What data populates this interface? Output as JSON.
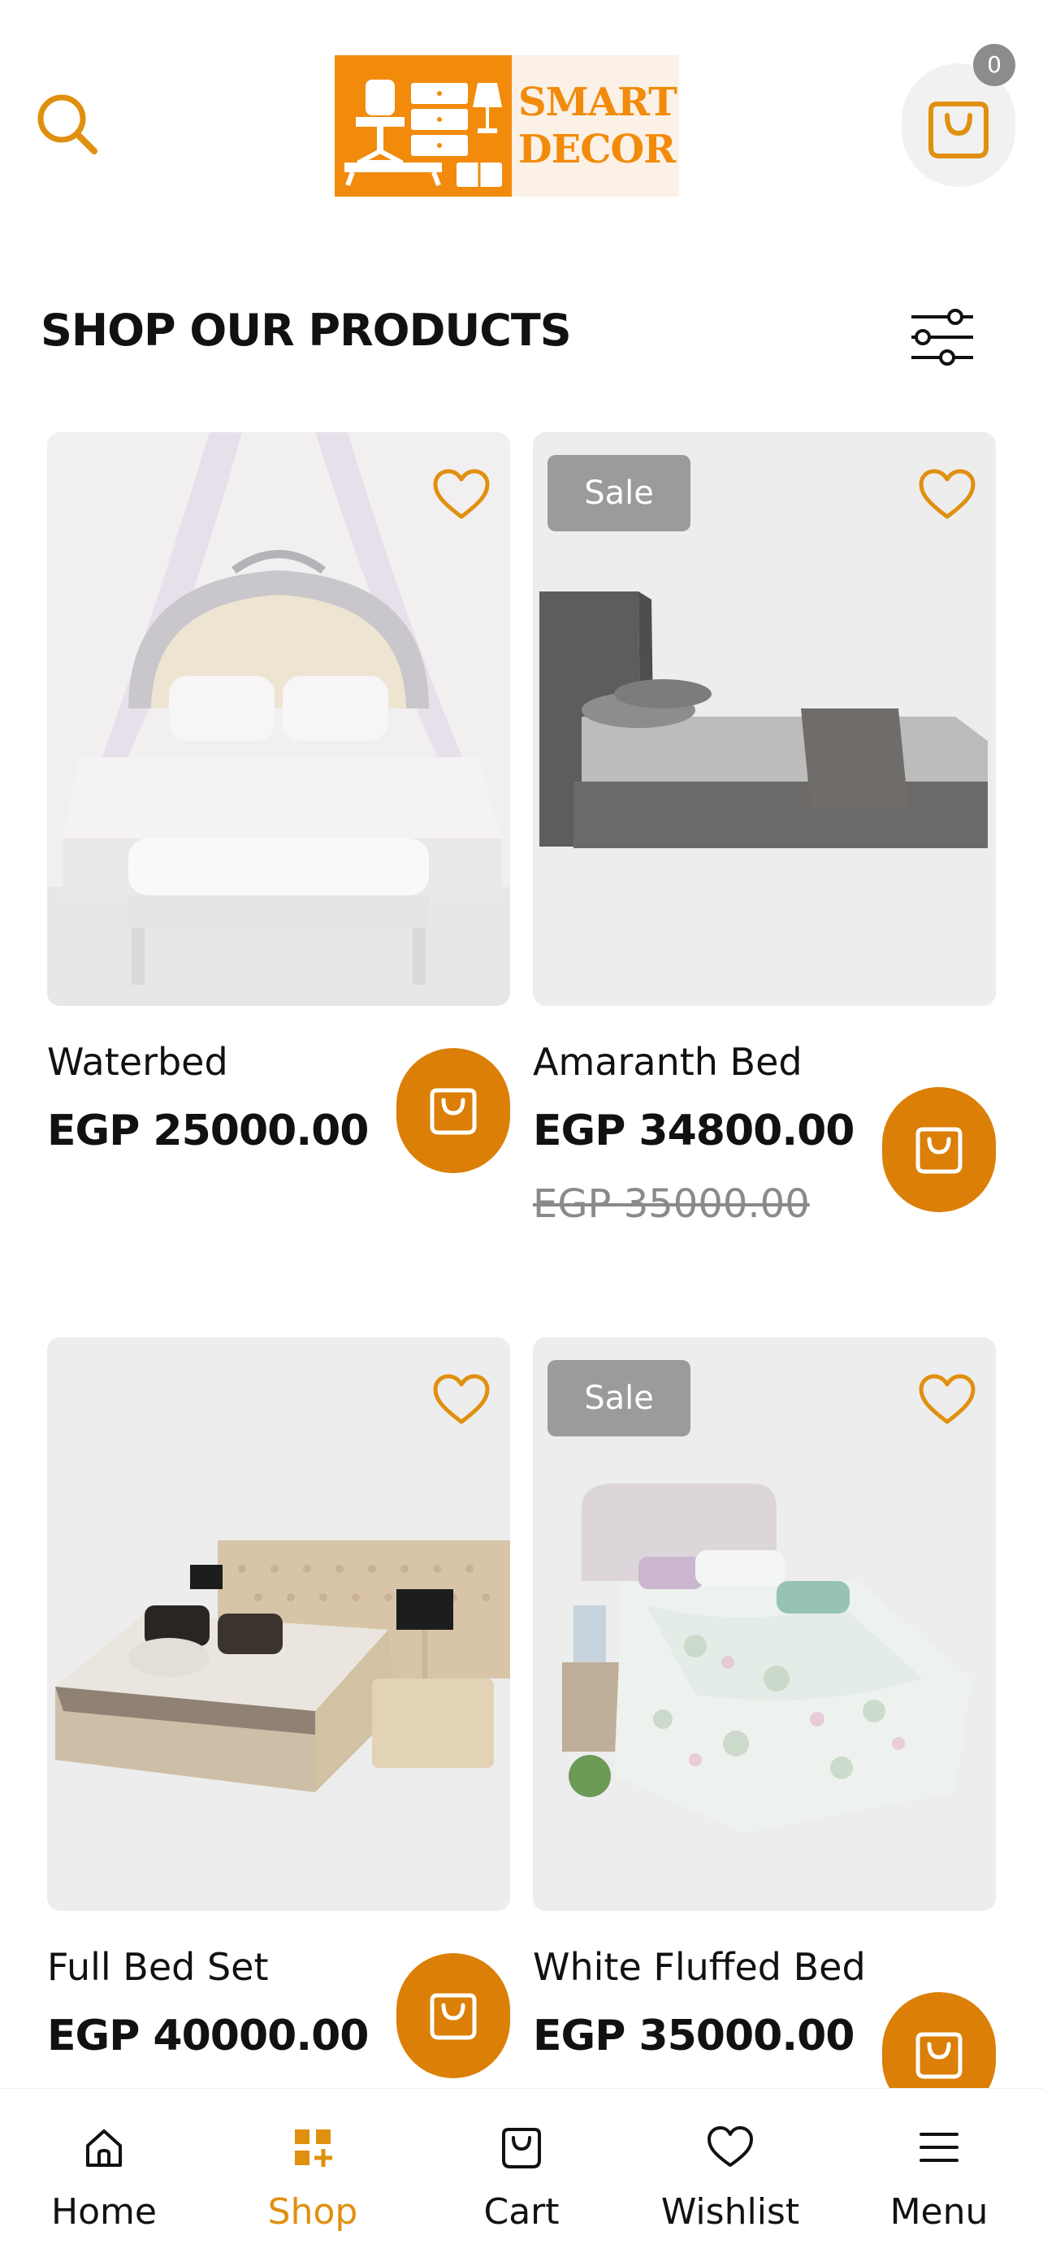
{
  "header": {
    "logo_line1": "SMART",
    "logo_line2": "DECOR",
    "cart_count": "0"
  },
  "section_title": "SHOP OUR PRODUCTS",
  "products": [
    {
      "name": "Waterbed",
      "price": "EGP 25000.00",
      "sale_badge": "",
      "old_price": ""
    },
    {
      "name": "Amaranth Bed",
      "price": "EGP 34800.00",
      "sale_badge": "Sale",
      "old_price": "EGP 35000.00"
    },
    {
      "name": "Full Bed Set",
      "price": "EGP 40000.00",
      "sale_badge": "",
      "old_price": ""
    },
    {
      "name": "White Fluffed Bed",
      "price": "EGP 35000.00",
      "sale_badge": "Sale",
      "old_price": ""
    }
  ],
  "bottom_nav": [
    {
      "label": "Home",
      "icon": "home-icon",
      "active": false
    },
    {
      "label": "Shop",
      "icon": "grid-plus-icon",
      "active": true
    },
    {
      "label": "Cart",
      "icon": "bag-icon",
      "active": false
    },
    {
      "label": "Wishlist",
      "icon": "heart-icon",
      "active": false
    },
    {
      "label": "Menu",
      "icon": "menu-icon",
      "active": false
    }
  ],
  "colors": {
    "accent": "#E0900F",
    "button": "#DB7F07",
    "logo_orange": "#F28B0C",
    "badge_gray": "#9B9B9B",
    "card_bg": "#EDEDED"
  }
}
